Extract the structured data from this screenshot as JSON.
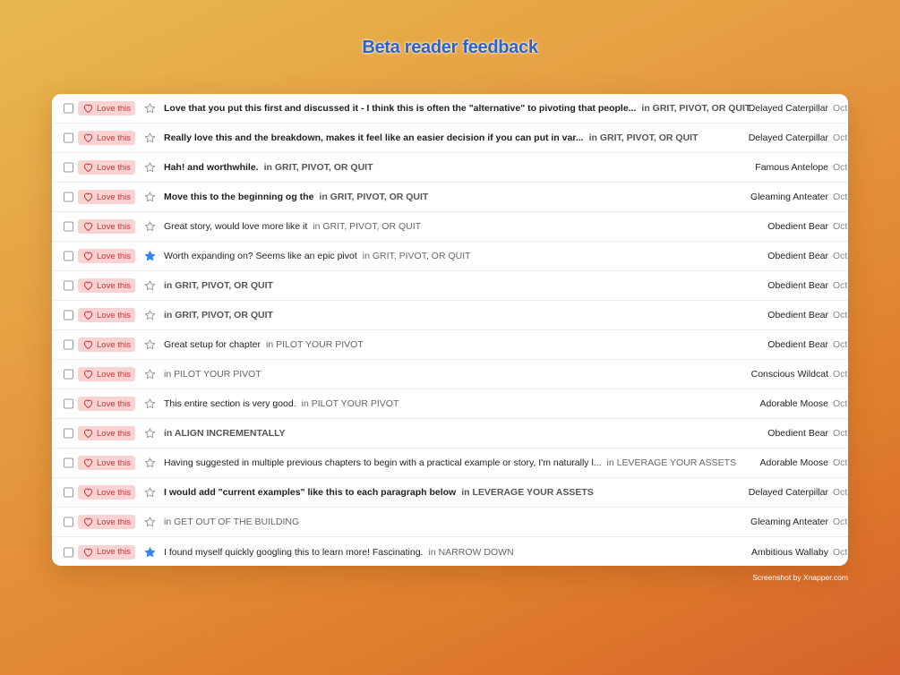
{
  "title": "Beta reader feedback",
  "love_label": "Love this",
  "footer": "Screenshot by Xnapper.com",
  "colors": {
    "title": "#2f62c8",
    "love_bg": "#fbd2d2",
    "love_fg": "#c33a3a",
    "star_active": "#3b82f6"
  },
  "rows": [
    {
      "text": "Love that you put this first and discussed it - I think this is often the \"alternative\" to pivoting that people...",
      "location": "in GRIT, PIVOT, OR QUIT",
      "author": "Delayed Caterpillar",
      "date": "Oct",
      "starred": false,
      "unread": true
    },
    {
      "text": "Really love this and the breakdown, makes it feel like an easier decision if you can put in var...",
      "location": "in GRIT, PIVOT, OR QUIT",
      "author": "Delayed Caterpillar",
      "date": "Oct",
      "starred": false,
      "unread": true
    },
    {
      "text": "Hah! and worthwhile.",
      "location": "in GRIT, PIVOT, OR QUIT",
      "author": "Famous Antelope",
      "date": "Oct",
      "starred": false,
      "unread": true
    },
    {
      "text": "Move this to the beginning og the",
      "location": "in GRIT, PIVOT, OR QUIT",
      "author": "Gleaming Anteater",
      "date": "Oct",
      "starred": false,
      "unread": true
    },
    {
      "text": "Great story, would love more like it",
      "location": "in GRIT, PIVOT, OR QUIT",
      "author": "Obedient Bear",
      "date": "Oct",
      "starred": false,
      "unread": false
    },
    {
      "text": "Worth expanding on? Seems like an epic pivot",
      "location": "in GRIT, PIVOT, OR QUIT",
      "author": "Obedient Bear",
      "date": "Oct",
      "starred": true,
      "unread": false
    },
    {
      "text": "",
      "location": "in GRIT, PIVOT, OR QUIT",
      "author": "Obedient Bear",
      "date": "Oct",
      "starred": false,
      "unread": true
    },
    {
      "text": "",
      "location": "in GRIT, PIVOT, OR QUIT",
      "author": "Obedient Bear",
      "date": "Oct",
      "starred": false,
      "unread": true
    },
    {
      "text": "Great setup for chapter",
      "location": "in PILOT YOUR PIVOT",
      "author": "Obedient Bear",
      "date": "Oct",
      "starred": false,
      "unread": false
    },
    {
      "text": "",
      "location": "in PILOT YOUR PIVOT",
      "author": "Conscious Wildcat",
      "date": "Oct",
      "starred": false,
      "unread": false
    },
    {
      "text": "This entire section is very good.",
      "location": "in PILOT YOUR PIVOT",
      "author": "Adorable Moose",
      "date": "Oct",
      "starred": false,
      "unread": false
    },
    {
      "text": "",
      "location": "in ALIGN INCREMENTALLY",
      "author": "Obedient Bear",
      "date": "Oct",
      "starred": false,
      "unread": true
    },
    {
      "text": "Having suggested in multiple previous chapters to begin with a practical example or story, I'm naturally l...",
      "location": "in LEVERAGE YOUR ASSETS",
      "author": "Adorable Moose",
      "date": "Oct",
      "starred": false,
      "unread": false
    },
    {
      "text": "I would add \"current examples\" like this to each paragraph below",
      "location": "in LEVERAGE YOUR ASSETS",
      "author": "Delayed Caterpillar",
      "date": "Oct",
      "starred": false,
      "unread": true
    },
    {
      "text": "",
      "location": "in GET OUT OF THE BUILDING",
      "author": "Gleaming Anteater",
      "date": "Oct",
      "starred": false,
      "unread": false
    },
    {
      "text": "I found myself quickly googling this to learn more! Fascinating.",
      "location": "in NARROW DOWN",
      "author": "Ambitious Wallaby",
      "date": "Oct",
      "starred": true,
      "unread": false
    }
  ]
}
